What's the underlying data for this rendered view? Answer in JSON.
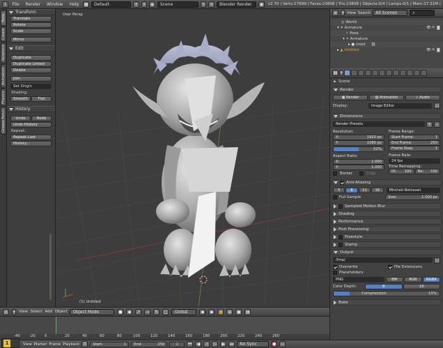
{
  "topbar": {
    "menus": [
      "File",
      "Render",
      "Window",
      "Help"
    ],
    "layout": "Default",
    "scene": "Scene",
    "engine": "Blender Render",
    "stats": "v2.70 | Verts:17699 | Faces:23808 | Tris:23808 | Objects:0/4 | Lamps:0/1 | Mem:17.31M ("
  },
  "tabs": [
    "Tools",
    "Create",
    "Relations",
    "Animation",
    "Physics",
    "Grease Pencil"
  ],
  "tools": {
    "transform_label": "Transform",
    "transform": [
      "Translate",
      "Rotate",
      "Scale"
    ],
    "mirror": "Mirror",
    "edit_label": "Edit",
    "edit": [
      "Duplicate",
      "Duplicate Linked",
      "Delete",
      "Join"
    ],
    "set_origin": "Set Origin",
    "shading_label": "Shading:",
    "smooth": "Smooth",
    "flat": "Flat",
    "history_label": "History",
    "undo": "Undo",
    "redo": "Redo",
    "undo_history": "Undo History",
    "repeat_label": "Repeat:",
    "repeat_last": "Repeat Last",
    "history": "History..."
  },
  "viewport": {
    "label": "User Persp",
    "object_label": "(1) Untitled"
  },
  "viewport_header": {
    "view": "View",
    "select": "Select",
    "add": "Add",
    "object": "Object",
    "mode": "Object Mode",
    "orientation": "Global"
  },
  "timeline": {
    "ticks": [
      "-40",
      "-20",
      "0",
      "20",
      "40",
      "60",
      "80",
      "100",
      "120",
      "140",
      "160",
      "180",
      "200",
      "220",
      "240",
      "260"
    ],
    "frame": "1"
  },
  "timeline_header": {
    "view": "View",
    "marker": "Marker",
    "frame": "Frame",
    "playback": "Playback",
    "start_label": "Start:",
    "start": "1",
    "end_label": "End:",
    "end": "250",
    "current": "1",
    "sync": "No Sync"
  },
  "outliner": {
    "view": "View",
    "search": "Search",
    "filter": "All Scenes",
    "items": [
      {
        "label": "World",
        "indent": 1
      },
      {
        "label": "Armature",
        "indent": 1
      },
      {
        "label": "Pose",
        "indent": 2
      },
      {
        "label": "Armature",
        "indent": 2
      },
      {
        "label": "croot",
        "indent": 3
      },
      {
        "label": "Untitled",
        "indent": 1
      }
    ]
  },
  "properties": {
    "scene": "Scene",
    "render_label": "Render",
    "render": "Render",
    "animation": "Animation",
    "audio": "Audio",
    "display_label": "Display:",
    "display": "Image Editor",
    "dimensions_label": "Dimensions",
    "render_presets": "Render Presets",
    "resolution_label": "Resolution:",
    "res_x_label": "X:",
    "res_x": "1920 px",
    "res_y_label": "Y:",
    "res_y": "1080 px",
    "res_pct": "50%",
    "frame_range_label": "Frame Range:",
    "start_frame_label": "Start Frame:",
    "start_frame": "1",
    "end_frame_label": "End Frame:",
    "end_frame": "250",
    "frame_step_label": "Frame Step:",
    "frame_step": "1",
    "aspect_label": "Aspect Ratio:",
    "asp_x_label": "X:",
    "asp_x": "1.000",
    "asp_y_label": "Y:",
    "asp_y": "1.000",
    "frame_rate_label": "Frame Rate:",
    "frame_rate": "24 fps",
    "time_remap_label": "Time Remapping:",
    "old_label": "Ol:",
    "old": "100",
    "new_label": "Ne:",
    "new": "100",
    "border": "Border",
    "crop": "Crop",
    "aa_label": "Anti-Aliasing",
    "aa_samples": [
      "5",
      "8",
      "11",
      "16"
    ],
    "aa_filter": "Mitchell-Netravali",
    "full_sample": "Full Sample",
    "size_label": "Size:",
    "size": "1.000 px",
    "sampled_motion_blur": "Sampled Motion Blur",
    "shading": "Shading",
    "performance": "Performance",
    "post_processing": "Post Processing",
    "freestyle": "Freestyle",
    "stamp": "Stamp",
    "output_label": "Output",
    "output_path": "/tmp/",
    "overwrite": "Overwrite",
    "file_extensions": "File Extensions",
    "placeholders": "Placeholders",
    "format": "PNG",
    "bw": "BW",
    "rgb": "RGB",
    "rgba": "RGBA",
    "color_depth_label": "Color Depth:",
    "depth_8": "8",
    "depth_16": "16",
    "compression_label": "Compression:",
    "compression": "15%",
    "compression_value": 0.15,
    "bake": "Bake"
  }
}
